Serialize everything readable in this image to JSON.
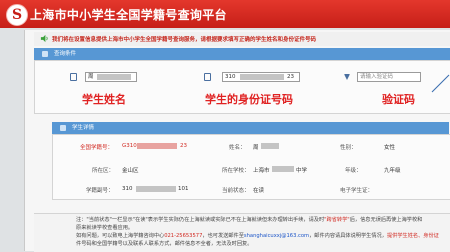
{
  "header": {
    "logo_letter": "S",
    "title": "上海市中小学生全国学籍号查询平台"
  },
  "notice": "我们将在设置信息提供上海市中小学生全国学籍号查询服务，请根据要求填写正确的学生姓名和身份证件号码",
  "query_section": {
    "title": "查询条件",
    "name_value": "周",
    "id_value": "310",
    "id_value_tail": "23",
    "captcha_placeholder": "请输入验证码"
  },
  "annotations": {
    "name": "学生姓名",
    "id": "学生的身份证号码",
    "captcha": "验证码"
  },
  "detail_section": {
    "title": "学生详情",
    "labels": {
      "national_id": "全国学籍号：",
      "name": "姓名：",
      "gender": "性别：",
      "district": "所在区：",
      "school": "所在学校：",
      "grade": "年级：",
      "local_id": "学籍副号：",
      "status": "当前状态：",
      "email": "电子学生证："
    },
    "values": {
      "national_id_prefix": "G310",
      "national_id_suffix": "23",
      "name": "周",
      "gender": "女性",
      "district": "金山区",
      "school_prefix": "上海市",
      "school_suffix": "中学",
      "grade": "九年级",
      "local_id_prefix": "310",
      "local_id_suffix": "101",
      "status": "在读"
    }
  },
  "footer": {
    "line1a": "注：\"当前状态\"一栏显示\"在读\"表示学生实际仍在上海就读或实际已不在上海就读但未办理转出手续，请及时",
    "line1_hl": "\"跨省转学\"",
    "line1b": "后，信息无误后再使上海学校和",
    "line2": "原来就读学校查看应用。",
    "line3a": "如有问题，可以致电上海学籍咨询中心",
    "line3_phone": "021-25653577",
    "line3b": "，也可发送邮件至",
    "line3_email": "shanghaicuxxj@163.com",
    "line3c": "，邮件内容请具体说明学生情况，",
    "line3_hl": "提供学生姓名、身份证",
    "line4": "件号码和全国学籍号以及联系人联系方式，邮件信息不全者，无法及时回复。"
  },
  "colors": {
    "banner": "#d92b22",
    "section_header": "#5797d4",
    "annotation": "#e02222"
  }
}
